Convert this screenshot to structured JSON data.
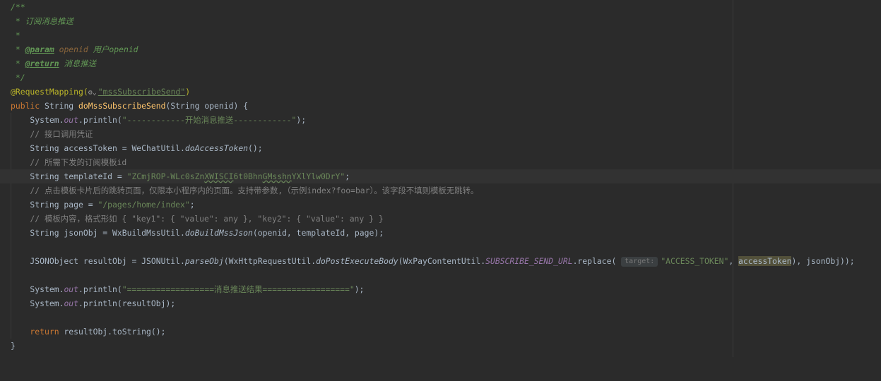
{
  "editor": {
    "lines": {
      "l1": "/**",
      "l2": " * 订阅消息推送",
      "l3": " *",
      "l4_prefix": " * ",
      "l4_tag": "@param",
      "l4_param": " openid",
      "l4_desc": " 用户openid",
      "l5_prefix": " * ",
      "l5_tag": "@return",
      "l5_desc": " 消息推送",
      "l6": " */",
      "l7_ann": "@RequestMapping(",
      "l7_icon": "⚙⌄",
      "l7_str": "\"mssSubscribeSend\"",
      "l7_close": ")",
      "l8_kw": "public",
      "l8_type": " String ",
      "l8_fn": "doMssSubscribeSend",
      "l8_rest": "(String openid) {",
      "l9_a": "    System.",
      "l9_out": "out",
      "l9_b": ".println(",
      "l9_str": "\"------------开始消息推送------------\"",
      "l9_c": ");",
      "l10": "    // 接口调用凭证",
      "l11_a": "    String accessToken = WeChatUtil.",
      "l11_fn": "doAccessToken",
      "l11_b": "();",
      "l12": "    // 所需下发的订阅模板id",
      "l13_a": "    String templateId = ",
      "l13_str_a": "\"ZCmjROP-WLc0sZn",
      "l13_str_b": "XWISCI",
      "l13_str_c": "6t0Bhn",
      "l13_str_d": "GMsshn",
      "l13_str_e": "YXlYlw0DrY\"",
      "l13_b": ";",
      "l14": "    // 点击模板卡片后的跳转页面，仅限本小程序内的页面。支持带参数,（示例index?foo=bar）。该字段不填则模板无跳转。",
      "l15_a": "    String page = ",
      "l15_str": "\"/pages/home/index\"",
      "l15_b": ";",
      "l16": "    // 模板内容，格式形如 { \"key1\": { \"value\": any }, \"key2\": { \"value\": any } }",
      "l17_a": "    String jsonObj = WxBuildMssUtil.",
      "l17_fn": "doBuildMssJson",
      "l17_b": "(openid, templateId, page);",
      "l19_a": "    JSONObject resultObj = JSONUtil.",
      "l19_fn1": "parseObj",
      "l19_b": "(WxHttpRequestUtil.",
      "l19_fn2": "doPostExecuteBody",
      "l19_c": "(WxPayContentUtil.",
      "l19_field": "SUBSCRIBE_SEND_URL",
      "l19_d": ".replace( ",
      "l19_hint": "target:",
      "l19_str": "\"ACCESS_TOKEN\"",
      "l19_e": ", ",
      "l19_hl": "accessToken",
      "l19_f": "), jsonObj));",
      "l21_a": "    System.",
      "l21_out": "out",
      "l21_b": ".println(",
      "l21_str": "\"==================消息推送结果==================\"",
      "l21_c": ");",
      "l22_a": "    System.",
      "l22_out": "out",
      "l22_b": ".println(resultObj);",
      "l24_kw": "    return",
      "l24_b": " resultObj.toString();",
      "l25": "}"
    }
  }
}
